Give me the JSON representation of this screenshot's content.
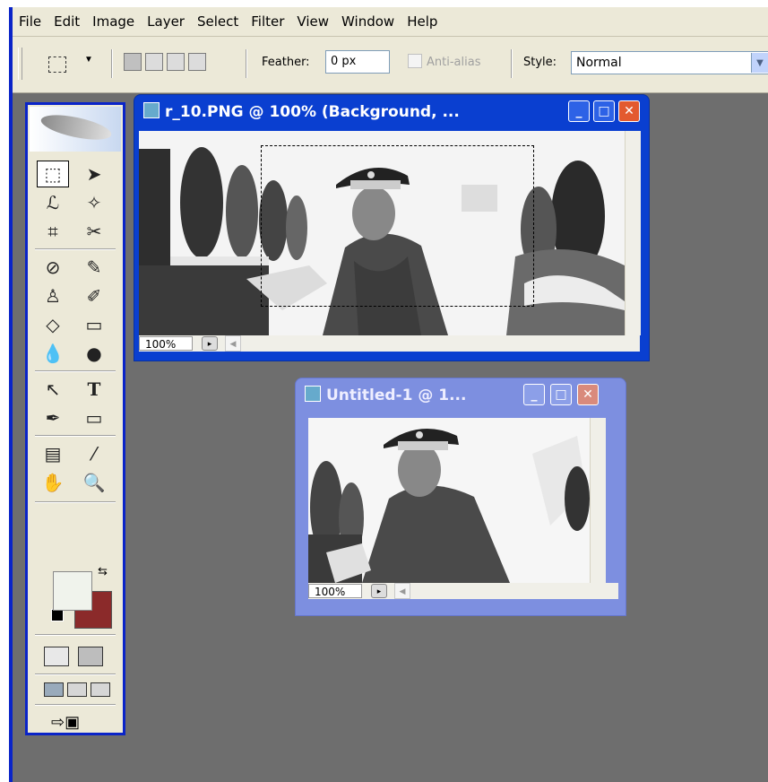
{
  "menubar": {
    "items": [
      "File",
      "Edit",
      "Image",
      "Layer",
      "Select",
      "Filter",
      "View",
      "Window",
      "Help"
    ]
  },
  "options": {
    "feather_label": "Feather:",
    "feather_value": "0 px",
    "antialias_label": "Anti-alias",
    "style_label": "Style:",
    "style_value": "Normal"
  },
  "toolbox": {
    "tools": [
      "rectangular-marquee",
      "move",
      "lasso",
      "magic-wand",
      "crop",
      "slice",
      "healing-brush",
      "brush",
      "clone-stamp",
      "history-brush",
      "eraser",
      "gradient",
      "blur",
      "dodge",
      "path-selection",
      "type",
      "pen",
      "rectangle-shape",
      "notes",
      "eyedropper",
      "hand",
      "zoom"
    ],
    "foreground_color": "#f0f3ec",
    "background_color": "#8b2a2a"
  },
  "documents": [
    {
      "title": "r_10.PNG @ 100% (Background, ...",
      "zoom": "100%",
      "active": true
    },
    {
      "title": "Untitled-1 @ 1...",
      "zoom": "100%",
      "active": false
    }
  ],
  "icons": {
    "minimize": "minimize-icon",
    "maximize": "maximize-icon",
    "close": "close-icon"
  }
}
